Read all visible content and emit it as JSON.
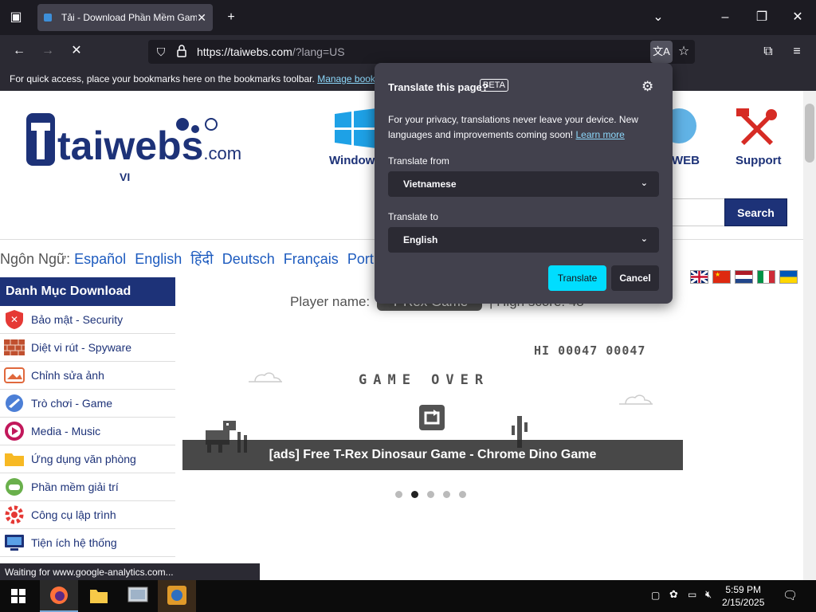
{
  "browser": {
    "tab_title": "Tải - Download Phần Mềm Game",
    "url_main": "https://taiwebs.com",
    "url_query": "/?lang=US",
    "bookmarks_text": "For quick access, place your bookmarks here on the bookmarks toolbar.",
    "bookmarks_link": "Manage bookmarks…",
    "status_text": "Waiting for www.google-analytics.com..."
  },
  "site": {
    "logo_main": "taiwebs",
    "logo_suffix": ".com",
    "logo_sub": "VI",
    "nav": [
      {
        "label": "Windows"
      },
      {
        "label": "WEB"
      },
      {
        "label": "Support"
      }
    ],
    "search_label": "Search",
    "lang_prefix": "Ngôn Ngữ:",
    "languages": [
      "Español",
      "English",
      "हिंदी",
      "Deutsch",
      "Français",
      "Port"
    ],
    "sidebar_title": "Danh Mục Download",
    "sidebar_items": [
      {
        "label": "Bảo mật - Security"
      },
      {
        "label": "Diệt vi rút - Spyware"
      },
      {
        "label": "Chỉnh sửa ảnh"
      },
      {
        "label": "Trò chơi - Game"
      },
      {
        "label": "Media - Music"
      },
      {
        "label": "Ứng dụng văn phòng"
      },
      {
        "label": "Phần mềm giải trí"
      },
      {
        "label": "Công cụ lập trình"
      },
      {
        "label": "Tiện ích hệ thống"
      }
    ]
  },
  "game": {
    "player_label": "Player name:",
    "player_name": "T-Rex Game",
    "high_score_label": "| High score: 48",
    "hi_score_display": "HI 00047 00047",
    "game_over": "GAME OVER",
    "caption": "[ads] Free T-Rex Dinosaur Game - Chrome Dino Game",
    "slides": 5,
    "active_slide": 1
  },
  "translate_popup": {
    "title": "Translate this page?",
    "badge": "BETA",
    "privacy_text": "For your privacy, translations never leave your device. New languages and improvements coming soon!",
    "learn_more": "Learn more",
    "from_label": "Translate from",
    "from_value": "Vietnamese",
    "to_label": "Translate to",
    "to_value": "English",
    "translate_button": "Translate",
    "cancel_button": "Cancel"
  },
  "taskbar": {
    "time": "5:59 PM",
    "date": "2/15/2025"
  },
  "colors": {
    "brand": "#1d3278",
    "accent": "#00ddff",
    "popup_bg": "#42414d"
  }
}
